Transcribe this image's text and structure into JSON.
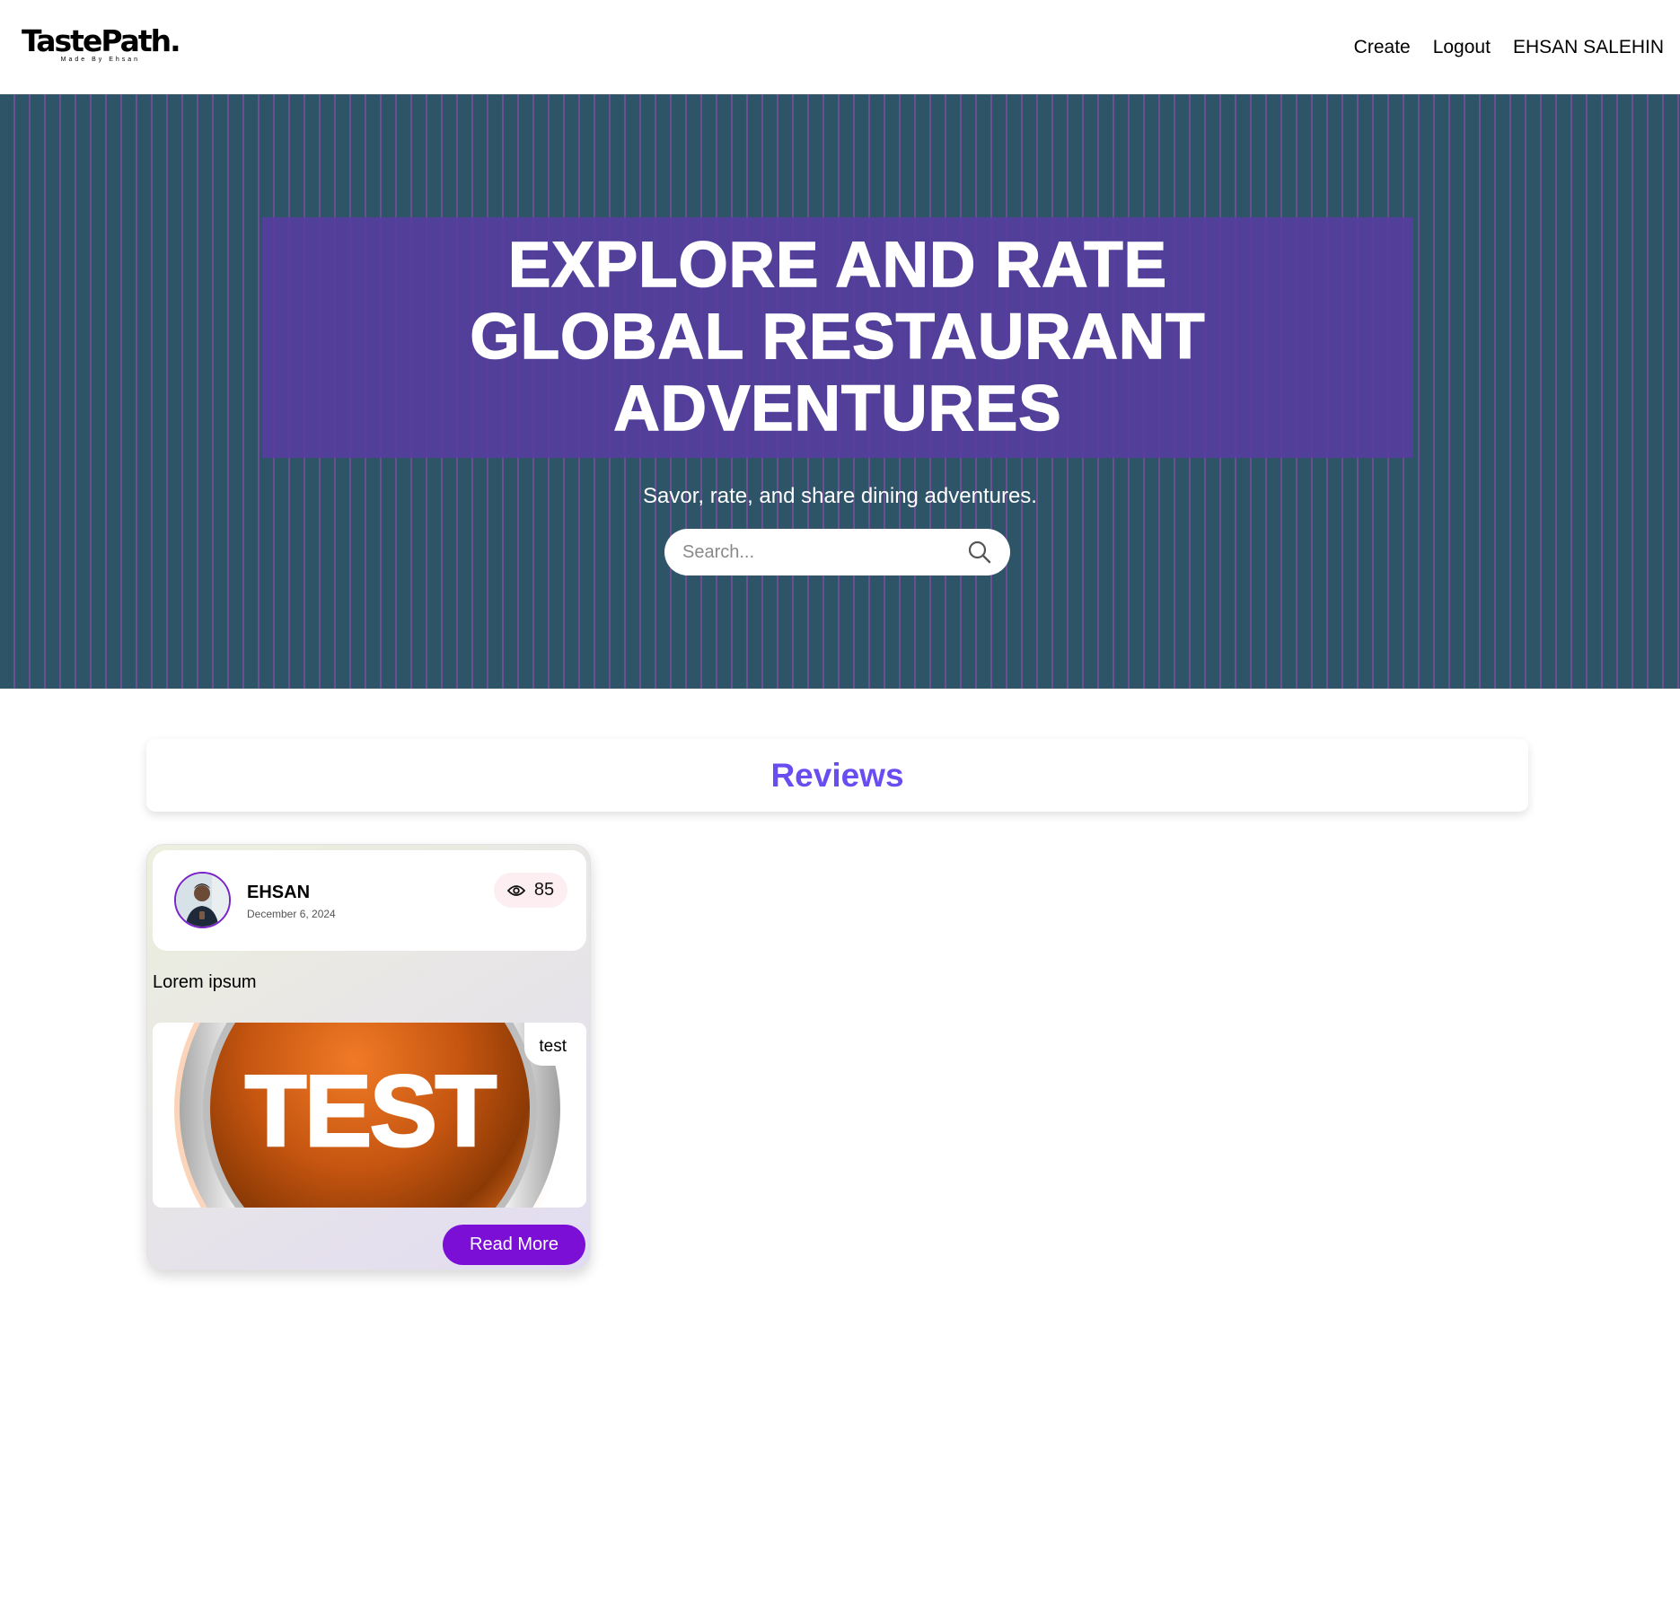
{
  "brand": {
    "name": "TastePath.",
    "tagline": "Made By Ehsan"
  },
  "nav": {
    "create": "Create",
    "logout": "Logout",
    "user": "EHSAN SALEHIN"
  },
  "hero": {
    "title": "EXPLORE AND RATE GLOBAL RESTAURANT ADVENTURES",
    "subtitle": "Savor, rate, and share dining adventures.",
    "search_placeholder": "Search...",
    "search_icon": "search-icon"
  },
  "reviews": {
    "title": "Reviews",
    "cards": [
      {
        "author": "EHSAN",
        "date": "December 6, 2024",
        "views": "85",
        "text": "Lorem ipsum",
        "image_text": "TEST",
        "tag": "test",
        "button": "Read More"
      }
    ]
  },
  "colors": {
    "hero_bg": "#2e5468",
    "hero_stripe": "#6a4f94",
    "hero_box": "#563ca0",
    "reviews_title": "#6a4df0",
    "button": "#7b0fd6",
    "views_badge_bg": "#fdeff1"
  }
}
